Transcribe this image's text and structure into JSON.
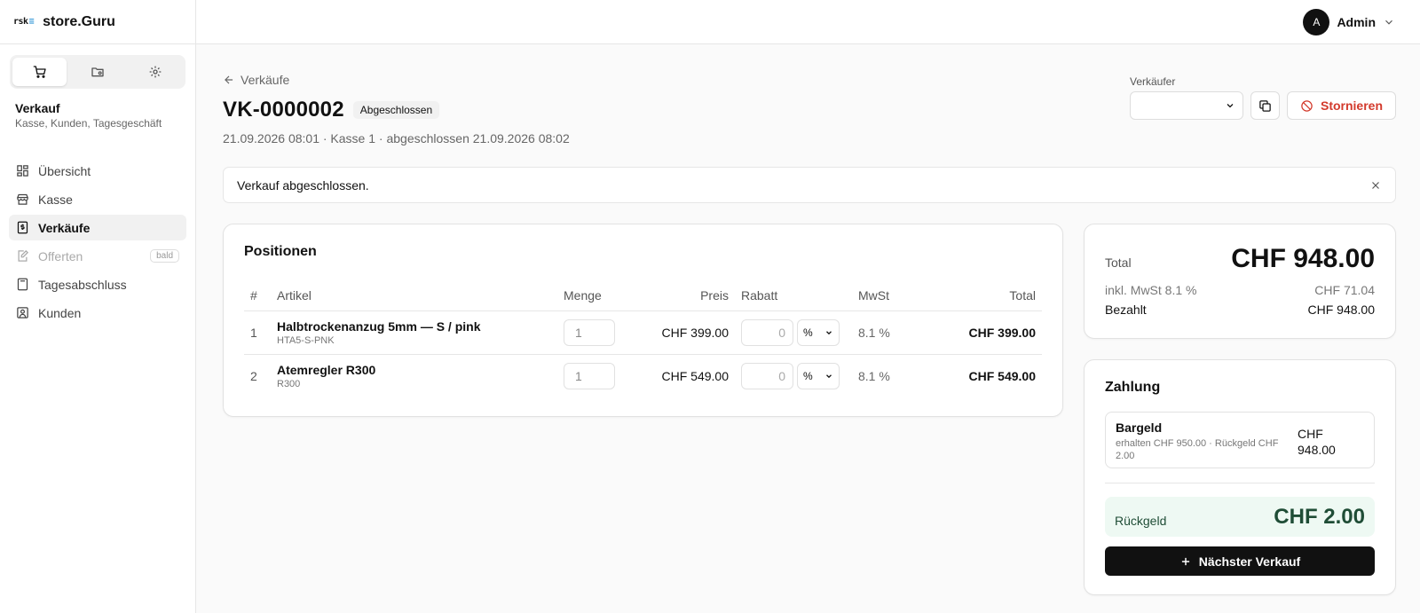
{
  "brand": {
    "logo_text": "rsk",
    "name": "store.Guru"
  },
  "sidebar": {
    "section_title": "Verkauf",
    "section_sub": "Kasse, Kunden, Tagesgeschäft",
    "items": [
      {
        "label": "Übersicht",
        "icon": "dashboard-icon"
      },
      {
        "label": "Kasse",
        "icon": "store-icon"
      },
      {
        "label": "Verkäufe",
        "icon": "receipt-icon",
        "active": true
      },
      {
        "label": "Offerten",
        "icon": "edit-document-icon",
        "disabled": true,
        "badge": "bald"
      },
      {
        "label": "Tagesabschluss",
        "icon": "calculator-icon"
      },
      {
        "label": "Kunden",
        "icon": "contact-icon"
      }
    ]
  },
  "user": {
    "initial": "A",
    "name": "Admin"
  },
  "page": {
    "back_label": "Verkäufe",
    "title": "VK-0000002",
    "status": "Abgeschlossen",
    "meta": "21.09.2026 08:01 · Kasse 1 · abgeschlossen 21.09.2026 08:02",
    "seller_label": "Verkäufer",
    "storno_label": "Stornieren",
    "alert": "Verkauf abgeschlossen."
  },
  "positions": {
    "title": "Positionen",
    "headers": {
      "num": "#",
      "article": "Artikel",
      "qty": "Menge",
      "price": "Preis",
      "discount": "Rabatt",
      "vat": "MwSt",
      "total": "Total"
    },
    "rows": [
      {
        "num": "1",
        "name": "Halbtrockenanzug 5mm — S / pink",
        "sku": "HTA5-S-PNK",
        "qty": "1",
        "price": "CHF 399.00",
        "discount": "0",
        "discount_type": "%",
        "vat": "8.1 %",
        "total": "CHF 399.00"
      },
      {
        "num": "2",
        "name": "Atemregler R300",
        "sku": "R300",
        "qty": "1",
        "price": "CHF 549.00",
        "discount": "0",
        "discount_type": "%",
        "vat": "8.1 %",
        "total": "CHF 549.00"
      }
    ]
  },
  "totals": {
    "total_label": "Total",
    "total_value": "CHF 948.00",
    "vat_label": "inkl. MwSt 8.1 %",
    "vat_value": "CHF 71.04",
    "paid_label": "Bezahlt",
    "paid_value": "CHF 948.00"
  },
  "payment": {
    "title": "Zahlung",
    "method": "Bargeld",
    "detail": "erhalten CHF 950.00 · Rückgeld CHF 2.00",
    "amount": "CHF 948.00",
    "change_label": "Rückgeld",
    "change_value": "CHF 2.00",
    "next_label": "Nächster Verkauf"
  }
}
